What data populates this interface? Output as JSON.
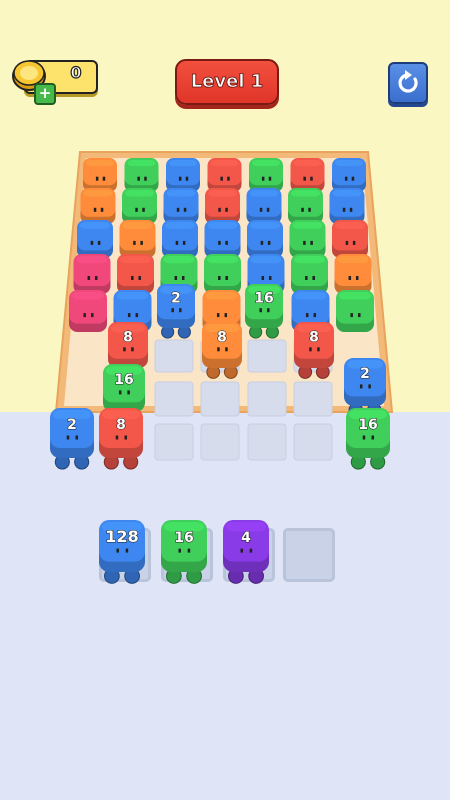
{
  "header": {
    "coins": "0",
    "level_label": "Level 1"
  },
  "icons": {
    "coin": "gold-coin-icon",
    "add": "plus-icon",
    "restart": "restart-icon"
  },
  "colors": {
    "orange": "#ff8c3a",
    "green": "#3fcf5a",
    "blue": "#3f87f0",
    "red": "#f2574a",
    "pink": "#f0487a",
    "purple": "#8a3be8",
    "wall": "#fbf7c2",
    "floor": "#dfe5f6",
    "level_button": "#e8392d",
    "restart_button": "#4a7fd9"
  },
  "board": {
    "back_rows": [
      [
        "orange",
        "green",
        "blue",
        "red",
        "green",
        "red",
        "blue"
      ],
      [
        "orange",
        "green",
        "blue",
        "red",
        "blue",
        "green",
        "blue"
      ],
      [
        "blue",
        "orange",
        "blue",
        "blue",
        "blue",
        "green",
        "red"
      ],
      [
        "pink",
        "red",
        "green",
        "green",
        "blue",
        "green",
        "orange"
      ],
      [
        "pink",
        "blue",
        "",
        "orange",
        "",
        "blue",
        "green"
      ]
    ],
    "active_cubes": [
      {
        "label": "2",
        "color": "blue"
      },
      {
        "label": "16",
        "color": "green"
      },
      {
        "label": "8",
        "color": "red"
      },
      {
        "label": "8",
        "color": "orange"
      },
      {
        "label": "8",
        "color": "red"
      },
      {
        "label": "16",
        "color": "green"
      },
      {
        "label": "2",
        "color": "blue"
      },
      {
        "label": "2",
        "color": "blue"
      },
      {
        "label": "8",
        "color": "red"
      },
      {
        "label": "16",
        "color": "green"
      }
    ]
  },
  "tray": {
    "cubes": [
      {
        "label": "128",
        "color": "blue"
      },
      {
        "label": "16",
        "color": "green"
      },
      {
        "label": "4",
        "color": "purple"
      }
    ],
    "empty_slots": 1
  }
}
